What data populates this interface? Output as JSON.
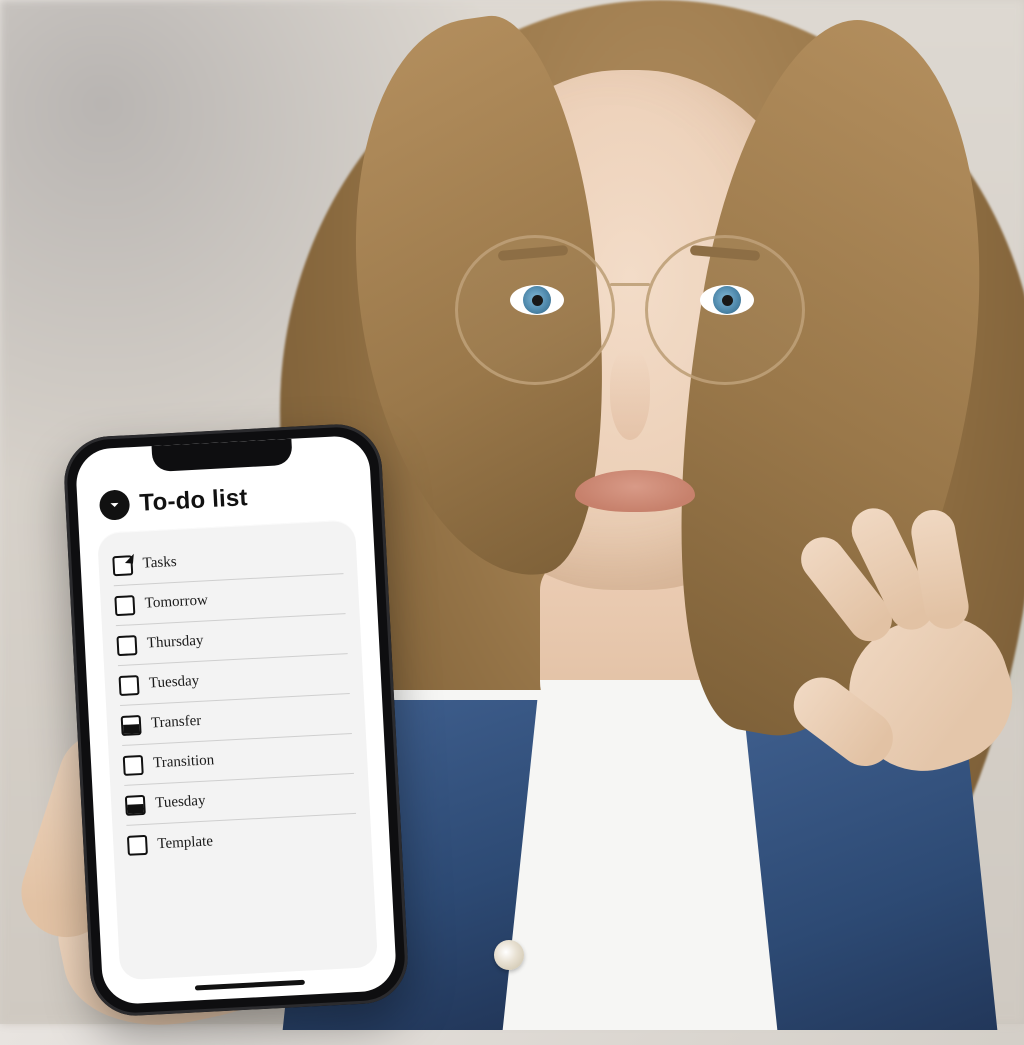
{
  "phone_app": {
    "title": "To-do list",
    "header_icon": "chevron-down-circle-icon",
    "items": [
      {
        "checked": true,
        "style": "tick",
        "label": "Tasks"
      },
      {
        "checked": false,
        "style": "none",
        "label": "Tomorrow"
      },
      {
        "checked": false,
        "style": "none",
        "label": "Thursday"
      },
      {
        "checked": false,
        "style": "none",
        "label": "Tuesday"
      },
      {
        "checked": true,
        "style": "bottomfill",
        "label": "Transfer"
      },
      {
        "checked": false,
        "style": "none",
        "label": "Transition"
      },
      {
        "checked": true,
        "style": "bottomfill",
        "label": "Tuesday"
      },
      {
        "checked": false,
        "style": "none",
        "label": "Template"
      }
    ]
  }
}
